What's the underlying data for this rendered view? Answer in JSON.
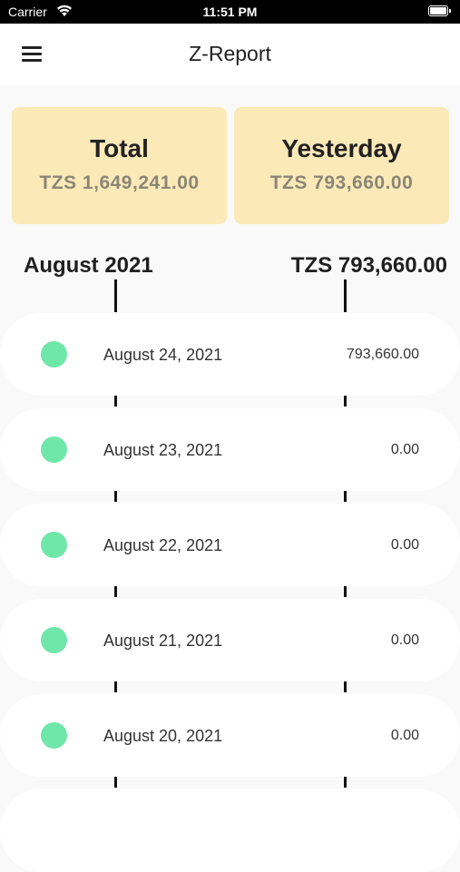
{
  "status_bar": {
    "carrier": "Carrier",
    "time": "11:51 PM"
  },
  "app_bar": {
    "title": "Z-Report",
    "menu_icon": "hamburger-menu-icon"
  },
  "summary": {
    "total": {
      "label": "Total",
      "amount": "TZS 1,649,241.00"
    },
    "yesterday": {
      "label": "Yesterday",
      "amount": "TZS 793,660.00"
    }
  },
  "month": {
    "label": "August 2021",
    "total": "TZS 793,660.00"
  },
  "days": [
    {
      "date": "August 24, 2021",
      "amount": "793,660.00"
    },
    {
      "date": "August 23, 2021",
      "amount": "0.00"
    },
    {
      "date": "August 22, 2021",
      "amount": "0.00"
    },
    {
      "date": "August 21, 2021",
      "amount": "0.00"
    },
    {
      "date": "August 20, 2021",
      "amount": "0.00"
    }
  ],
  "colors": {
    "card_bg": "#fce9b8",
    "status_dot": "#6ee7a9",
    "card_amount": "#8a8676"
  }
}
